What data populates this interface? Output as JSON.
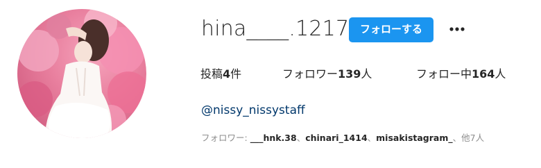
{
  "profile": {
    "username": "hina____.1217",
    "follow_label": "フォローする",
    "more_icon": "more-horizontal-icon",
    "stats": {
      "posts_label": "投稿",
      "posts_value": "4",
      "posts_unit": "件",
      "followers_label": "フォロワー",
      "followers_value": "139",
      "followers_unit": "人",
      "following_label": "フォロー中",
      "following_value": "164",
      "following_unit": "人"
    },
    "link": "@nissy_nissystaff",
    "followed_by": {
      "prefix": "フォロワー: ",
      "accounts": [
        "___hnk.38",
        "chinari_1414",
        "misakistagram_"
      ],
      "separator": "、",
      "others": "他7人"
    }
  },
  "colors": {
    "button_blue": "#1b95f0",
    "link_blue": "#00376b",
    "muted_gray": "#8e8e8e"
  }
}
